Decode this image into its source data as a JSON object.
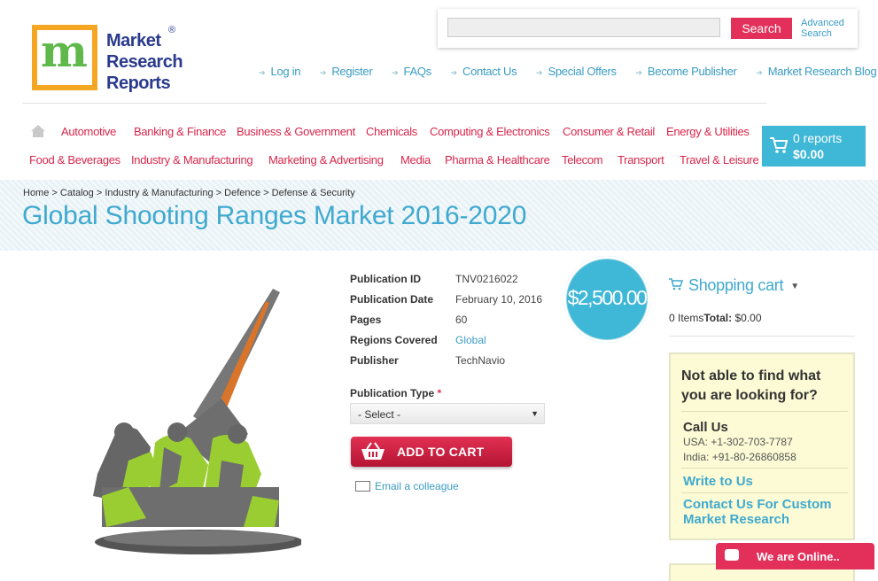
{
  "logo": {
    "line1": "Market",
    "line2": "Research",
    "line3": "Reports",
    "reg": "®",
    "mark": "m"
  },
  "search": {
    "placeholder": "",
    "button_label": "Search",
    "advanced_line1": "Advanced",
    "advanced_line2": "Search"
  },
  "top_links": [
    "Log in",
    "Register",
    "FAQs",
    "Contact Us",
    "Special Offers",
    "Become Publisher",
    "Market Research Blog"
  ],
  "categories_row1": [
    "Automotive",
    "Banking & Finance",
    "Business & Government",
    "Chemicals",
    "Computing & Electronics",
    "Consumer & Retail",
    "Energy & Utilities"
  ],
  "categories_row2": [
    "Food & Beverages",
    "Industry & Manufacturing",
    "Marketing & Advertising",
    "Media",
    "Pharma & Healthcare",
    "Telecom",
    "Transport",
    "Travel & Leisure"
  ],
  "cart": {
    "reports": "0 reports",
    "total": "$0.00"
  },
  "breadcrumb": "Home > Catalog > Industry & Manufacturing > Defence > Defense & Security",
  "page_title": "Global Shooting Ranges Market 2016-2020",
  "details": [
    {
      "label": "Publication ID",
      "value": "TNV0216022"
    },
    {
      "label": "Publication Date",
      "value": "February 10, 2016"
    },
    {
      "label": "Pages",
      "value": "60"
    },
    {
      "label": "Regions Covered",
      "value": "Global"
    },
    {
      "label": "Publisher",
      "value": "TechNavio"
    }
  ],
  "price": "$2,500.00",
  "publication_type": {
    "label": "Publication Type",
    "required": "*",
    "selected": "- Select -"
  },
  "add_to_cart": "ADD TO CART",
  "email_colleague": "Email a colleague",
  "shopping_cart": {
    "title": "Shopping cart",
    "items": "0 Items",
    "total_label": "Total:",
    "total": "$0.00"
  },
  "help_box": {
    "heading": "Not able to find what you are looking for?",
    "call_heading": "Call Us",
    "usa": "USA: +1-302-703-7787",
    "india": "India: +91-80-26860858",
    "write": "Write to Us",
    "custom": "Contact Us For Custom Market Research"
  },
  "chat": "We are Online..",
  "colors": {
    "accent_pink": "#e2305b",
    "accent_blue": "#3fb7d6",
    "title_blue": "#3fa9cf"
  }
}
